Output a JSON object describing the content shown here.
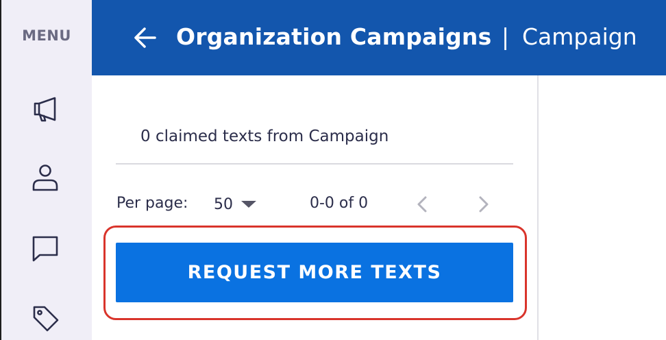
{
  "sidebar": {
    "menu_label": "MENU",
    "items": [
      {
        "icon": "megaphone-icon"
      },
      {
        "icon": "person-icon"
      },
      {
        "icon": "chat-icon"
      },
      {
        "icon": "tag-icon"
      }
    ]
  },
  "header": {
    "back_icon": "arrow-left-icon",
    "title": "Organization Campaigns",
    "separator": "|",
    "subtitle": "Campaign"
  },
  "panel": {
    "claimed_text": "0 claimed texts from Campaign",
    "per_page_label": "Per page:",
    "per_page_value": "50",
    "range_text": "0-0 of 0",
    "prev_icon": "chevron-left-icon",
    "next_icon": "chevron-right-icon",
    "request_button_label": "REQUEST MORE TEXTS"
  },
  "colors": {
    "header_bg": "#1356ad",
    "sidebar_bg": "#f0eef7",
    "button_bg": "#0a72e1",
    "highlight": "#d9342b",
    "text": "#2b2d4a"
  }
}
